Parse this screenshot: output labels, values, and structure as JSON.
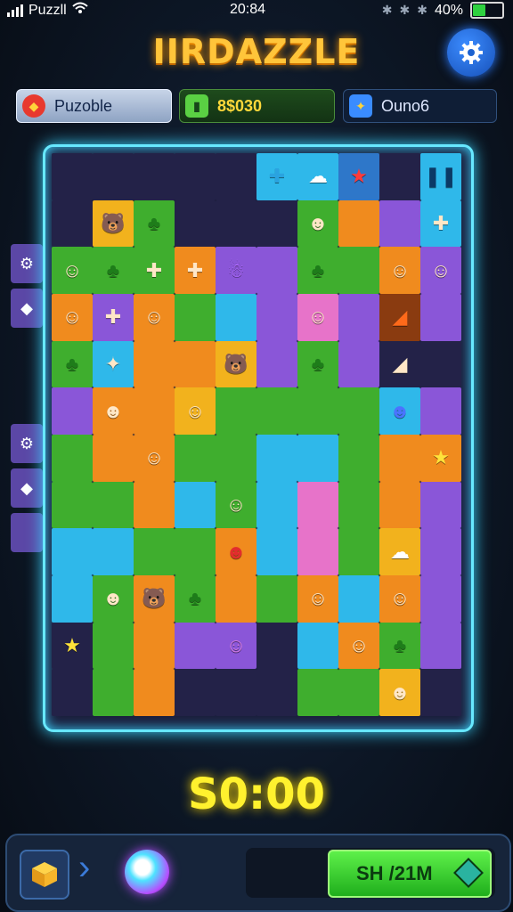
{
  "status_bar": {
    "carrier": "Puzzll",
    "time": "20:84",
    "battery_percent": "40%",
    "battery_level": 0.4
  },
  "title": "IIRDAZZLE",
  "info_bar": {
    "mode_label": "Puzoble",
    "score": "8$030",
    "right_label": "Ouno6"
  },
  "timer": "S0:00",
  "bottom_bar": {
    "action_label": "SH /21M"
  },
  "colors": {
    "purple": "#8a56d8",
    "dark": "#25244a",
    "green": "#3fae2e",
    "orange": "#f08b1e",
    "yellow": "#f2b21d",
    "blue": "#2fb8ea",
    "pink": "#e773c9",
    "accent_glow": "#67e8ff",
    "timer_yellow": "#fff12e"
  },
  "board": {
    "rows": [
      [
        "dark",
        "dark",
        "dark",
        "dark",
        "dark",
        "blue",
        "blue",
        "red",
        "dark",
        "blue"
      ],
      [
        "dark",
        "yellow",
        "green",
        "dark",
        "dark",
        "dark",
        "green",
        "orange",
        "purple",
        "blue"
      ],
      [
        "green",
        "green",
        "green",
        "orange",
        "purple",
        "purple",
        "green",
        "green",
        "orange",
        "purple"
      ],
      [
        "orange",
        "purple",
        "orange",
        "green",
        "blue",
        "purple",
        "pink",
        "purple",
        "brown",
        "purple"
      ],
      [
        "green",
        "blue",
        "orange",
        "orange",
        "yellow",
        "purple",
        "green",
        "purple",
        "dark",
        "dark"
      ],
      [
        "purple",
        "orange",
        "orange",
        "yellow",
        "green",
        "green",
        "green",
        "green",
        "blue",
        "purple"
      ],
      [
        "green",
        "orange",
        "orange",
        "green",
        "green",
        "blue",
        "blue",
        "green",
        "orange",
        "orange"
      ],
      [
        "green",
        "green",
        "orange",
        "blue",
        "green",
        "blue",
        "pink",
        "green",
        "orange",
        "purple"
      ],
      [
        "blue",
        "blue",
        "green",
        "green",
        "orange",
        "blue",
        "pink",
        "green",
        "yellow",
        "purple"
      ],
      [
        "blue",
        "green",
        "orange",
        "green",
        "orange",
        "green",
        "orange",
        "blue",
        "orange",
        "purple"
      ],
      [
        "dark",
        "green",
        "orange",
        "purple",
        "purple",
        "dark",
        "blue",
        "orange",
        "green",
        "purple"
      ],
      [
        "dark",
        "green",
        "orange",
        "dark",
        "dark",
        "dark",
        "green",
        "green",
        "yellow",
        "dark"
      ]
    ],
    "icons": [
      [
        "",
        "",
        "",
        "",
        "",
        "plus-icon",
        "cloud-icon",
        "star-red-icon",
        "",
        "pause-icon"
      ],
      [
        "",
        "bear-icon",
        "tree-monster-icon",
        "",
        "",
        "",
        "zombie-icon",
        "",
        "",
        "puzzle-piece-icon"
      ],
      [
        "alien-icon",
        "tree-monster-icon",
        "puzzle-piece-icon",
        "puzzle-piece-icon",
        "ghost-purple-icon",
        "",
        "tree-monster-icon",
        "",
        "chicken-icon",
        "blob-icon"
      ],
      [
        "monkey-icon",
        "puzzle-piece-icon",
        "girl-icon",
        "",
        "",
        "",
        "doll-icon",
        "",
        "knife-icon",
        ""
      ],
      [
        "tree-monster-icon",
        "sparkle-icon",
        "",
        "",
        "bear-icon",
        "",
        "tree-monster-icon",
        "",
        "slope-icon",
        ""
      ],
      [
        "",
        "clown-icon",
        "",
        "kid-icon",
        "",
        "",
        "",
        "",
        "blue-robot-icon",
        ""
      ],
      [
        "",
        "",
        "robot-icon",
        "",
        "",
        "",
        "",
        "",
        "",
        "star-yellow-icon"
      ],
      [
        "",
        "",
        "",
        "",
        "gecko-icon",
        "",
        "",
        "",
        "",
        ""
      ],
      [
        "",
        "",
        "",
        "",
        "red-monster-icon",
        "",
        "",
        "",
        "ghost-white-icon",
        ""
      ],
      [
        "",
        "zombie-icon",
        "bear-icon",
        "tree-monster-icon",
        "",
        "",
        "monkey-icon",
        "",
        "monkey-icon",
        ""
      ],
      [
        "star-yellow-icon",
        "",
        "",
        "",
        "pig-icon",
        "",
        "",
        "robot-icon",
        "tree-monster-icon",
        ""
      ],
      [
        "",
        "",
        "",
        "",
        "",
        "",
        "",
        "",
        "yellow-monster-icon",
        ""
      ]
    ]
  },
  "side_tiles": [
    "puzzle-piece-icon",
    "diamond-icon",
    "puzzle-piece-icon",
    "diamond-icon",
    ""
  ]
}
